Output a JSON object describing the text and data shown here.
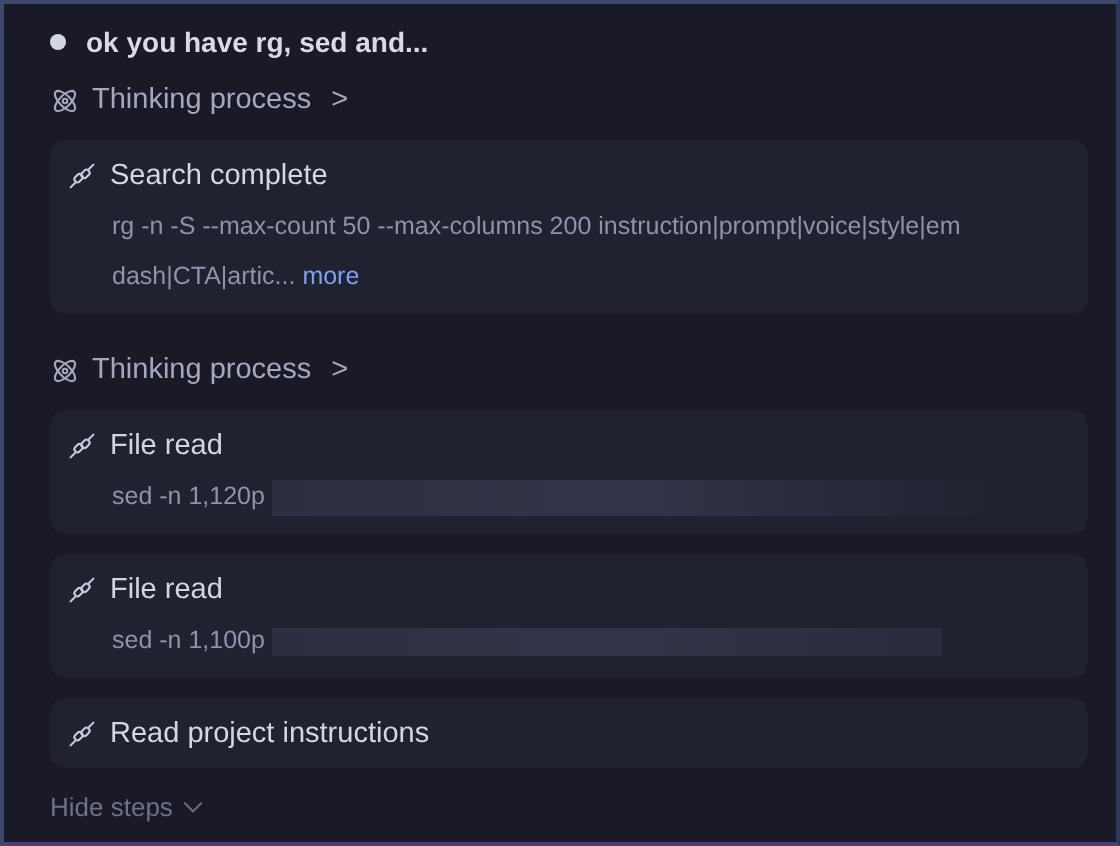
{
  "header": {
    "title": "ok you have rg, sed and..."
  },
  "steps": [
    {
      "kind": "thinking",
      "label": "Thinking process",
      "chevron": ">"
    },
    {
      "kind": "tool",
      "title": "Search complete",
      "detail": "rg -n -S --max-count 50 --max-columns 200 instruction|prompt|voice|style|em dash|CTA|artic...",
      "link": "more"
    },
    {
      "kind": "thinking",
      "label": "Thinking process",
      "chevron": ">"
    },
    {
      "kind": "tool",
      "title": "File read",
      "detail": "sed -n 1,120p",
      "redacted": true
    },
    {
      "kind": "tool",
      "title": "File read",
      "detail": "sed -n 1,100p",
      "redacted": true
    },
    {
      "kind": "tool",
      "title": "Read project instructions"
    }
  ],
  "footer": {
    "label": "Hide steps"
  }
}
